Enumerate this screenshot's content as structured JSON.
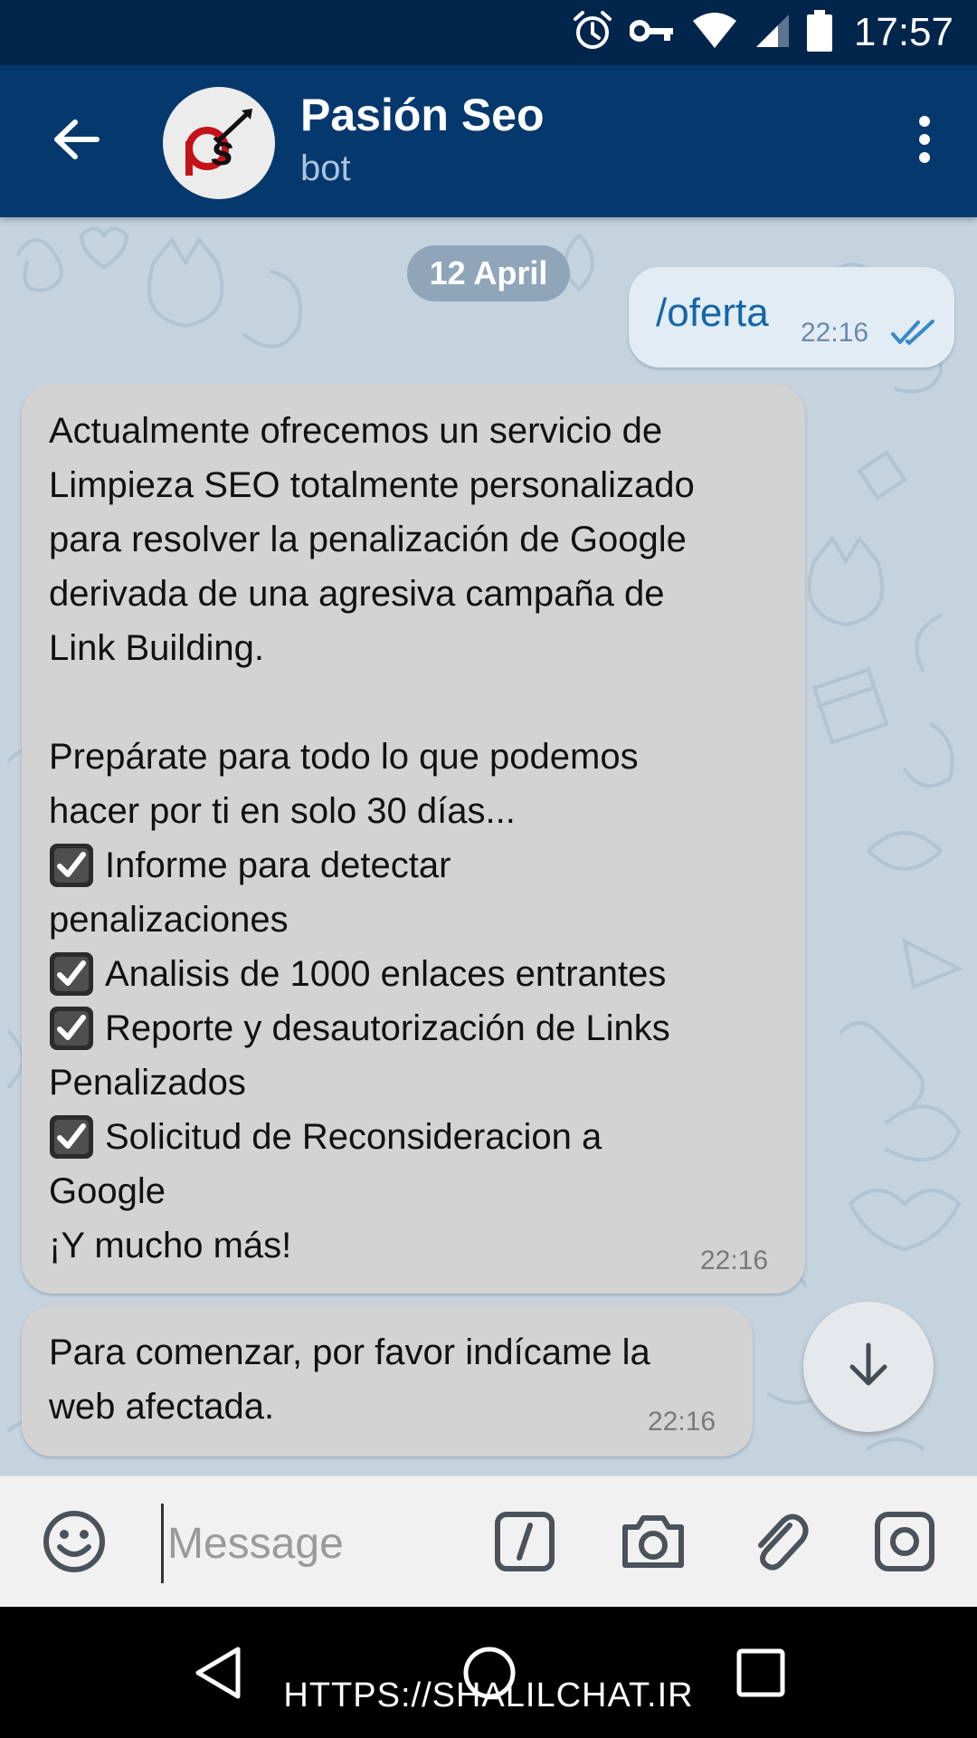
{
  "status_bar": {
    "time": "17:57",
    "icons": [
      "alarm-icon",
      "vpn-key-icon",
      "wifi-icon",
      "signal-icon",
      "battery-icon"
    ]
  },
  "header": {
    "title": "Pasión Seo",
    "subtitle": "bot",
    "avatar_logo": "PS",
    "icons": [
      "back-arrow-icon",
      "more-vert-icon"
    ]
  },
  "chat": {
    "date_chip": "12 April",
    "outgoing": {
      "text": "/oferta",
      "time": "22:16",
      "status_icon": "double-check-icon"
    },
    "messages": [
      {
        "lines": [
          {
            "text": "Actualmente ofrecemos un servicio de"
          },
          {
            "text": "Limpieza SEO totalmente personalizado"
          },
          {
            "text": "para resolver la penalización de Google"
          },
          {
            "text": "derivada de una agresiva campaña de"
          },
          {
            "text": "Link Building."
          },
          {
            "text": ""
          },
          {
            "text": "Prepárate para todo lo que podemos"
          },
          {
            "text": "hacer por ti en solo 30 días..."
          },
          {
            "text": "Informe para detectar",
            "check": true
          },
          {
            "text": "penalizaciones"
          },
          {
            "text": "Analisis de 1000 enlaces entrantes",
            "check": true
          },
          {
            "text": "Reporte y desautorización de Links",
            "check": true
          },
          {
            "text": "Penalizados"
          },
          {
            "text": "Solicitud de Reconsideracion a",
            "check": true
          },
          {
            "text": "Google"
          },
          {
            "text": "¡Y mucho más!"
          }
        ],
        "time": "22:16"
      },
      {
        "lines": [
          {
            "text": "Para comenzar, por favor indícame la"
          },
          {
            "text": "web afectada."
          }
        ],
        "time": "22:16"
      }
    ]
  },
  "input_bar": {
    "placeholder": "Message",
    "icons": [
      "emoji-icon",
      "bot-command-icon",
      "camera-icon",
      "attach-icon",
      "instagram-icon"
    ]
  },
  "nav_bar": {
    "icons": [
      "nav-back-icon",
      "nav-home-icon",
      "nav-recents-icon"
    ]
  },
  "watermark": "HTTPS://SHALILCHAT.IR",
  "colors": {
    "status_bar": "#02254b",
    "app_bar": "#05386d",
    "chat_background": "#c5d3df",
    "incoming_bubble": "#d3d3d3",
    "outgoing_bubble": "#e1ecf5",
    "outgoing_text": "#1565a6",
    "date_chip": "#8fa6ba"
  }
}
